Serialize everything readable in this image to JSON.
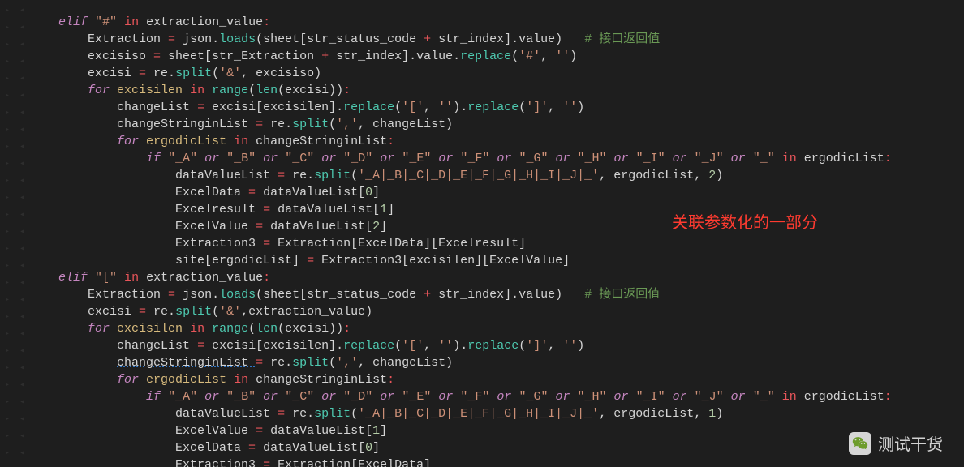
{
  "annotation_text": "关联参数化的一部分",
  "watermark_text": "测试干货",
  "colors": {
    "bg": "#1e1e1e",
    "fg": "#d4d4d4",
    "keyword": "#c586c0",
    "string": "#ce9178",
    "number": "#b5cea8",
    "func": "#4ec9b0",
    "comment": "#6a9955",
    "op": "#e8555a",
    "ident": "#d7ba7d",
    "annotation": "#ff3b30"
  },
  "code_lines": [
    {
      "indent": 1,
      "tokens": [
        {
          "t": "elif",
          "c": "k"
        },
        {
          "t": " "
        },
        {
          "t": "\"#\"",
          "c": "s"
        },
        {
          "t": " "
        },
        {
          "t": "in",
          "c": "o"
        },
        {
          "t": " extraction_value"
        },
        {
          "t": ":",
          "c": "o"
        }
      ]
    },
    {
      "indent": 2,
      "tokens": [
        {
          "t": "Extraction "
        },
        {
          "t": "=",
          "c": "o"
        },
        {
          "t": " json."
        },
        {
          "t": "loads",
          "c": "f"
        },
        {
          "t": "(sheet[str_status_code "
        },
        {
          "t": "+",
          "c": "o"
        },
        {
          "t": " str_index].value)   "
        },
        {
          "t": "# 接口返回值",
          "c": "c"
        }
      ]
    },
    {
      "indent": 2,
      "tokens": [
        {
          "t": "excisiso "
        },
        {
          "t": "=",
          "c": "o"
        },
        {
          "t": " sheet[str_Extraction "
        },
        {
          "t": "+",
          "c": "o"
        },
        {
          "t": " str_index].value."
        },
        {
          "t": "replace",
          "c": "f"
        },
        {
          "t": "("
        },
        {
          "t": "'#'",
          "c": "s"
        },
        {
          "t": ", "
        },
        {
          "t": "''",
          "c": "s"
        },
        {
          "t": ")"
        }
      ]
    },
    {
      "indent": 2,
      "tokens": [
        {
          "t": "excisi "
        },
        {
          "t": "=",
          "c": "o"
        },
        {
          "t": " re."
        },
        {
          "t": "split",
          "c": "f"
        },
        {
          "t": "("
        },
        {
          "t": "'&'",
          "c": "s"
        },
        {
          "t": ", excisiso)"
        }
      ]
    },
    {
      "indent": 2,
      "tokens": [
        {
          "t": "for",
          "c": "k"
        },
        {
          "t": " excisilen ",
          "c": "id"
        },
        {
          "t": "in",
          "c": "o"
        },
        {
          "t": " "
        },
        {
          "t": "range",
          "c": "f"
        },
        {
          "t": "("
        },
        {
          "t": "len",
          "c": "f"
        },
        {
          "t": "(excisi))"
        },
        {
          "t": ":",
          "c": "o"
        }
      ]
    },
    {
      "indent": 3,
      "tokens": [
        {
          "t": "changeList "
        },
        {
          "t": "=",
          "c": "o"
        },
        {
          "t": " excisi[excisilen]."
        },
        {
          "t": "replace",
          "c": "f"
        },
        {
          "t": "("
        },
        {
          "t": "'['",
          "c": "s"
        },
        {
          "t": ", "
        },
        {
          "t": "''",
          "c": "s"
        },
        {
          "t": ")."
        },
        {
          "t": "replace",
          "c": "f"
        },
        {
          "t": "("
        },
        {
          "t": "']'",
          "c": "s"
        },
        {
          "t": ", "
        },
        {
          "t": "''",
          "c": "s"
        },
        {
          "t": ")"
        }
      ]
    },
    {
      "indent": 3,
      "tokens": [
        {
          "t": "changeStringinList "
        },
        {
          "t": "=",
          "c": "o"
        },
        {
          "t": " re."
        },
        {
          "t": "split",
          "c": "f"
        },
        {
          "t": "("
        },
        {
          "t": "','",
          "c": "s"
        },
        {
          "t": ", changeList)"
        }
      ]
    },
    {
      "indent": 3,
      "tokens": [
        {
          "t": "for",
          "c": "k"
        },
        {
          "t": " ergodicList ",
          "c": "id"
        },
        {
          "t": "in",
          "c": "o"
        },
        {
          "t": " changeStringinList"
        },
        {
          "t": ":",
          "c": "o"
        }
      ]
    },
    {
      "indent": 4,
      "tokens": [
        {
          "t": "if",
          "c": "k"
        },
        {
          "t": " "
        },
        {
          "t": "\"_A\"",
          "c": "s"
        },
        {
          "t": " "
        },
        {
          "t": "or",
          "c": "k"
        },
        {
          "t": " "
        },
        {
          "t": "\"_B\"",
          "c": "s"
        },
        {
          "t": " "
        },
        {
          "t": "or",
          "c": "k"
        },
        {
          "t": " "
        },
        {
          "t": "\"_C\"",
          "c": "s"
        },
        {
          "t": " "
        },
        {
          "t": "or",
          "c": "k"
        },
        {
          "t": " "
        },
        {
          "t": "\"_D\"",
          "c": "s"
        },
        {
          "t": " "
        },
        {
          "t": "or",
          "c": "k"
        },
        {
          "t": " "
        },
        {
          "t": "\"_E\"",
          "c": "s"
        },
        {
          "t": " "
        },
        {
          "t": "or",
          "c": "k"
        },
        {
          "t": " "
        },
        {
          "t": "\"_F\"",
          "c": "s"
        },
        {
          "t": " "
        },
        {
          "t": "or",
          "c": "k"
        },
        {
          "t": " "
        },
        {
          "t": "\"_G\"",
          "c": "s"
        },
        {
          "t": " "
        },
        {
          "t": "or",
          "c": "k"
        },
        {
          "t": " "
        },
        {
          "t": "\"_H\"",
          "c": "s"
        },
        {
          "t": " "
        },
        {
          "t": "or",
          "c": "k"
        },
        {
          "t": " "
        },
        {
          "t": "\"_I\"",
          "c": "s"
        },
        {
          "t": " "
        },
        {
          "t": "or",
          "c": "k"
        },
        {
          "t": " "
        },
        {
          "t": "\"_J\"",
          "c": "s"
        },
        {
          "t": " "
        },
        {
          "t": "or",
          "c": "k"
        },
        {
          "t": " "
        },
        {
          "t": "\"_\"",
          "c": "s"
        },
        {
          "t": " "
        },
        {
          "t": "in",
          "c": "o"
        },
        {
          "t": " ergodicList"
        },
        {
          "t": ":",
          "c": "o"
        }
      ]
    },
    {
      "indent": 5,
      "tokens": [
        {
          "t": "dataValueList "
        },
        {
          "t": "=",
          "c": "o"
        },
        {
          "t": " re."
        },
        {
          "t": "split",
          "c": "f"
        },
        {
          "t": "("
        },
        {
          "t": "'_A|_B|_C|_D|_E|_F|_G|_H|_I|_J|_'",
          "c": "s"
        },
        {
          "t": ", ergodicList, "
        },
        {
          "t": "2",
          "c": "n"
        },
        {
          "t": ")"
        }
      ]
    },
    {
      "indent": 5,
      "tokens": [
        {
          "t": "ExcelData "
        },
        {
          "t": "=",
          "c": "o"
        },
        {
          "t": " dataValueList["
        },
        {
          "t": "0",
          "c": "n"
        },
        {
          "t": "]"
        }
      ]
    },
    {
      "indent": 5,
      "tokens": [
        {
          "t": "Excelresult "
        },
        {
          "t": "=",
          "c": "o"
        },
        {
          "t": " dataValueList["
        },
        {
          "t": "1",
          "c": "n"
        },
        {
          "t": "]"
        }
      ]
    },
    {
      "indent": 5,
      "tokens": [
        {
          "t": "ExcelValue "
        },
        {
          "t": "=",
          "c": "o"
        },
        {
          "t": " dataValueList["
        },
        {
          "t": "2",
          "c": "n"
        },
        {
          "t": "]"
        }
      ]
    },
    {
      "indent": 5,
      "tokens": [
        {
          "t": "Extraction3 "
        },
        {
          "t": "=",
          "c": "o"
        },
        {
          "t": " Extraction[ExcelData][Excelresult]"
        }
      ]
    },
    {
      "indent": 5,
      "tokens": [
        {
          "t": "site[ergodicList] "
        },
        {
          "t": "=",
          "c": "o"
        },
        {
          "t": " Extraction3[excisilen][ExcelValue]"
        }
      ]
    },
    {
      "indent": 1,
      "tokens": [
        {
          "t": "elif",
          "c": "k"
        },
        {
          "t": " "
        },
        {
          "t": "\"[\"",
          "c": "s"
        },
        {
          "t": " "
        },
        {
          "t": "in",
          "c": "o"
        },
        {
          "t": " extraction_value"
        },
        {
          "t": ":",
          "c": "o"
        }
      ]
    },
    {
      "indent": 2,
      "tokens": [
        {
          "t": "Extraction "
        },
        {
          "t": "=",
          "c": "o"
        },
        {
          "t": " json."
        },
        {
          "t": "loads",
          "c": "f"
        },
        {
          "t": "(sheet[str_status_code "
        },
        {
          "t": "+",
          "c": "o"
        },
        {
          "t": " str_index].value)   "
        },
        {
          "t": "# 接口返回值",
          "c": "c"
        }
      ]
    },
    {
      "indent": 2,
      "tokens": [
        {
          "t": "excisi "
        },
        {
          "t": "=",
          "c": "o"
        },
        {
          "t": " re."
        },
        {
          "t": "split",
          "c": "f"
        },
        {
          "t": "("
        },
        {
          "t": "'&'",
          "c": "s"
        },
        {
          "t": ",extraction_value)"
        }
      ]
    },
    {
      "indent": 2,
      "tokens": [
        {
          "t": "for",
          "c": "k"
        },
        {
          "t": " excisilen ",
          "c": "id"
        },
        {
          "t": "in",
          "c": "o"
        },
        {
          "t": " "
        },
        {
          "t": "range",
          "c": "f"
        },
        {
          "t": "("
        },
        {
          "t": "len",
          "c": "f"
        },
        {
          "t": "(excisi))"
        },
        {
          "t": ":",
          "c": "o"
        }
      ]
    },
    {
      "indent": 3,
      "tokens": [
        {
          "t": "changeList "
        },
        {
          "t": "=",
          "c": "o"
        },
        {
          "t": " excisi[excisilen]."
        },
        {
          "t": "replace",
          "c": "f"
        },
        {
          "t": "("
        },
        {
          "t": "'['",
          "c": "s"
        },
        {
          "t": ", "
        },
        {
          "t": "''",
          "c": "s"
        },
        {
          "t": ")."
        },
        {
          "t": "replace",
          "c": "f"
        },
        {
          "t": "("
        },
        {
          "t": "']'",
          "c": "s"
        },
        {
          "t": ", "
        },
        {
          "t": "''",
          "c": "s"
        },
        {
          "t": ")"
        }
      ]
    },
    {
      "indent": 3,
      "tokens": [
        {
          "t": "changeStringinList ",
          "sq": true
        },
        {
          "t": "=",
          "c": "o"
        },
        {
          "t": " re."
        },
        {
          "t": "split",
          "c": "f"
        },
        {
          "t": "("
        },
        {
          "t": "','",
          "c": "s"
        },
        {
          "t": ", changeList)"
        }
      ]
    },
    {
      "indent": 3,
      "tokens": [
        {
          "t": "for",
          "c": "k"
        },
        {
          "t": " ergodicList ",
          "c": "id"
        },
        {
          "t": "in",
          "c": "o"
        },
        {
          "t": " changeStringinList"
        },
        {
          "t": ":",
          "c": "o"
        }
      ]
    },
    {
      "indent": 4,
      "tokens": [
        {
          "t": "if",
          "c": "k"
        },
        {
          "t": " "
        },
        {
          "t": "\"_A\"",
          "c": "s"
        },
        {
          "t": " "
        },
        {
          "t": "or",
          "c": "k"
        },
        {
          "t": " "
        },
        {
          "t": "\"_B\"",
          "c": "s"
        },
        {
          "t": " "
        },
        {
          "t": "or",
          "c": "k"
        },
        {
          "t": " "
        },
        {
          "t": "\"_C\"",
          "c": "s"
        },
        {
          "t": " "
        },
        {
          "t": "or",
          "c": "k"
        },
        {
          "t": " "
        },
        {
          "t": "\"_D\"",
          "c": "s"
        },
        {
          "t": " "
        },
        {
          "t": "or",
          "c": "k"
        },
        {
          "t": " "
        },
        {
          "t": "\"_E\"",
          "c": "s"
        },
        {
          "t": " "
        },
        {
          "t": "or",
          "c": "k"
        },
        {
          "t": " "
        },
        {
          "t": "\"_F\"",
          "c": "s"
        },
        {
          "t": " "
        },
        {
          "t": "or",
          "c": "k"
        },
        {
          "t": " "
        },
        {
          "t": "\"_G\"",
          "c": "s"
        },
        {
          "t": " "
        },
        {
          "t": "or",
          "c": "k"
        },
        {
          "t": " "
        },
        {
          "t": "\"_H\"",
          "c": "s"
        },
        {
          "t": " "
        },
        {
          "t": "or",
          "c": "k"
        },
        {
          "t": " "
        },
        {
          "t": "\"_I\"",
          "c": "s"
        },
        {
          "t": " "
        },
        {
          "t": "or",
          "c": "k"
        },
        {
          "t": " "
        },
        {
          "t": "\"_J\"",
          "c": "s"
        },
        {
          "t": " "
        },
        {
          "t": "or",
          "c": "k"
        },
        {
          "t": " "
        },
        {
          "t": "\"_\"",
          "c": "s"
        },
        {
          "t": " "
        },
        {
          "t": "in",
          "c": "o"
        },
        {
          "t": " ergodicList"
        },
        {
          "t": ":",
          "c": "o"
        }
      ]
    },
    {
      "indent": 5,
      "tokens": [
        {
          "t": "dataValueList "
        },
        {
          "t": "=",
          "c": "o"
        },
        {
          "t": " re."
        },
        {
          "t": "split",
          "c": "f"
        },
        {
          "t": "("
        },
        {
          "t": "'_A|_B|_C|_D|_E|_F|_G|_H|_I|_J|_'",
          "c": "s"
        },
        {
          "t": ", ergodicList, "
        },
        {
          "t": "1",
          "c": "n"
        },
        {
          "t": ")"
        }
      ]
    },
    {
      "indent": 5,
      "tokens": [
        {
          "t": "ExcelValue "
        },
        {
          "t": "=",
          "c": "o"
        },
        {
          "t": " dataValueList["
        },
        {
          "t": "1",
          "c": "n"
        },
        {
          "t": "]"
        }
      ]
    },
    {
      "indent": 5,
      "tokens": [
        {
          "t": "ExcelData "
        },
        {
          "t": "=",
          "c": "o"
        },
        {
          "t": " dataValueList["
        },
        {
          "t": "0",
          "c": "n"
        },
        {
          "t": "]"
        }
      ]
    },
    {
      "indent": 5,
      "tokens": [
        {
          "t": "Extraction3 "
        },
        {
          "t": "=",
          "c": "o"
        },
        {
          "t": " Extraction[ExcelData]"
        }
      ]
    }
  ]
}
